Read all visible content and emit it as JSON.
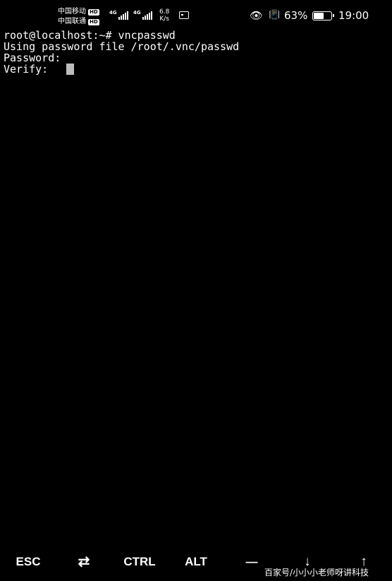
{
  "status_bar": {
    "carrier_1": "中国移动",
    "carrier_2": "中国联通",
    "hd_badge": "HD",
    "network_1": "4G",
    "network_2": "4G",
    "speed_value": "6.8",
    "speed_unit": "K/s",
    "battery_percent": "63%",
    "battery_level": 0.63,
    "time": "19:00",
    "icons": [
      "eye-icon",
      "vibrate-icon",
      "screen-record-icon",
      "battery-icon",
      "signal-icon"
    ]
  },
  "terminal": {
    "lines": [
      "root@localhost:~# vncpasswd",
      "Using password file /root/.vnc/passwd",
      "Password:",
      "Verify:"
    ]
  },
  "extra_keys": {
    "esc": "ESC",
    "tab": "⇄",
    "ctrl": "CTRL",
    "alt": "ALT",
    "minus": "—",
    "down": "↓",
    "up": "↑"
  },
  "watermark": "百家号/小小小老师呀讲科技"
}
